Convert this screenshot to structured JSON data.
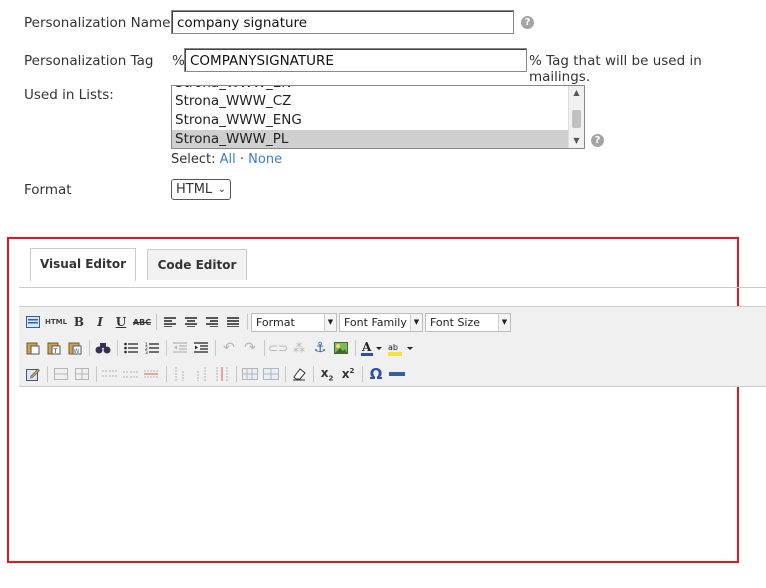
{
  "form": {
    "name_label": "Personalization Name",
    "name_value": "company signature",
    "tag_label": "Personalization Tag",
    "tag_prefix": "%",
    "tag_value": "COMPANYSIGNATURE",
    "tag_suffix": "% Tag that will be used in mailings.",
    "lists_label": "Used in Lists:",
    "lists": [
      "Strona_WWW_CZ",
      "Strona_WWW_ENG",
      "Strona_WWW_PL"
    ],
    "lists_selected": "Strona_WWW_PL",
    "select_label": "Select:",
    "select_all": "All",
    "select_sep": "·",
    "select_none": "None",
    "format_label": "Format",
    "format_value": "HTML",
    "help_icon": "?"
  },
  "editor": {
    "tabs": [
      "Visual Editor",
      "Code Editor"
    ],
    "active_tab": "Visual Editor",
    "dropdowns": {
      "format": "Format",
      "font_family": "Font Family",
      "font_size": "Font Size"
    },
    "html_label": "HTML"
  },
  "colors": {
    "highlight_frame": "#e3161b",
    "link": "#3a7bd5",
    "selected_option": "#cfcfcf"
  }
}
